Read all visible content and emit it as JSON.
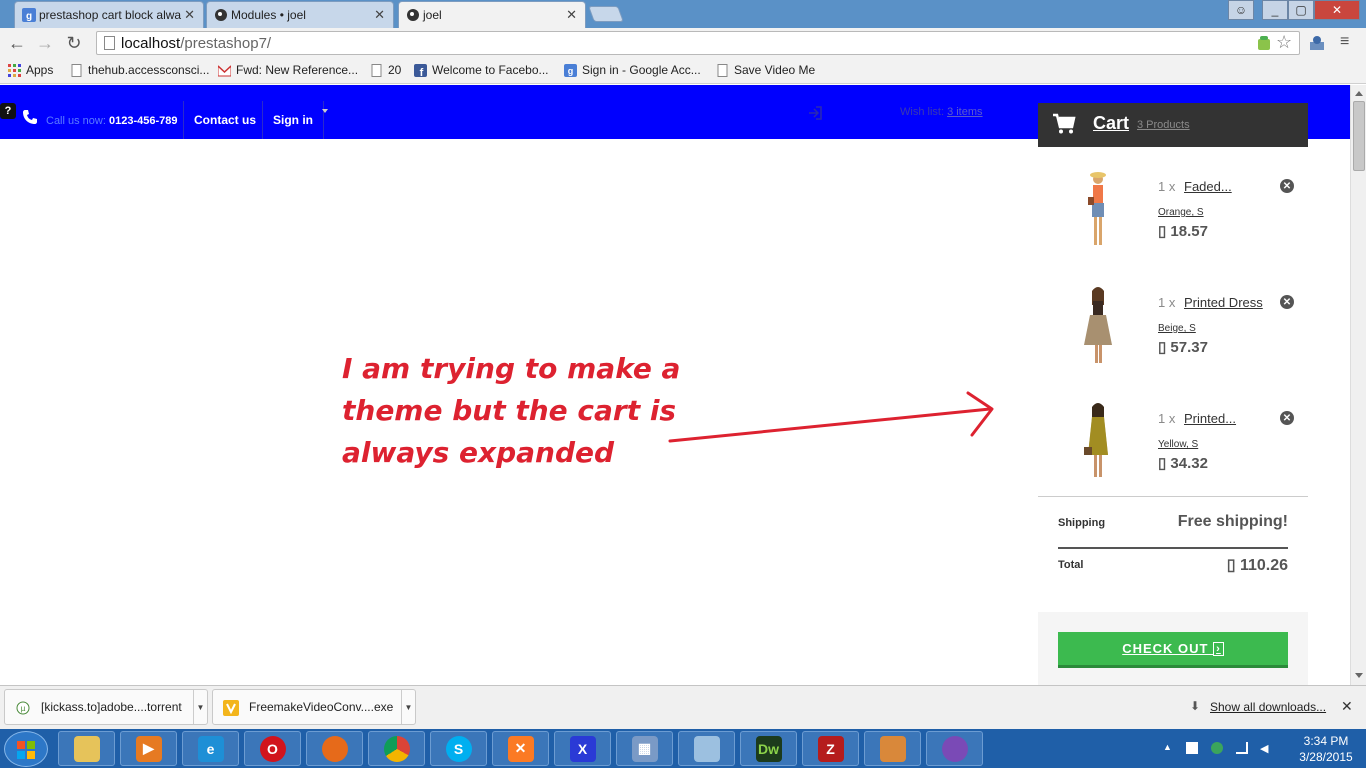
{
  "browser": {
    "tabs": [
      {
        "title": "prestashop cart block alwa"
      },
      {
        "title": "Modules • joel"
      },
      {
        "title": "joel"
      }
    ],
    "url_host": "localhost",
    "url_path": "/prestashop7/"
  },
  "bookmarks": [
    {
      "label": "Apps",
      "icon": "apps-grid-icon"
    },
    {
      "label": "thehub.accessconsci...",
      "icon": "page-icon"
    },
    {
      "label": "Fwd: New Reference...",
      "icon": "gmail-icon"
    },
    {
      "label": "20",
      "icon": "page-icon"
    },
    {
      "label": "Welcome to Facebo...",
      "icon": "facebook-icon"
    },
    {
      "label": "Sign in - Google Acc...",
      "icon": "google-icon"
    },
    {
      "label": "Save Video Me",
      "icon": "page-icon"
    }
  ],
  "header": {
    "help": "?",
    "call_label": "Call us now:",
    "phone": "0123-456-789",
    "contact": "Contact us",
    "signin": "Sign in",
    "wishlist_label": "Wish list:",
    "wishlist_count": "3 items"
  },
  "cart": {
    "title": "Cart",
    "count_label": "3 Products",
    "items": [
      {
        "qty": "1 x",
        "name": "Faded...",
        "attrs": "Orange, S",
        "price": " 18.57"
      },
      {
        "qty": "1 x",
        "name": "Printed Dress",
        "attrs": "Beige, S",
        "price": " 57.37"
      },
      {
        "qty": "1 x",
        "name": "Printed...",
        "attrs": "Yellow, S",
        "price": " 34.32"
      }
    ],
    "shipping_label": "Shipping",
    "shipping_value": "Free shipping!",
    "total_label": "Total",
    "total_value": " 110.26",
    "checkout": "CHECK OUT"
  },
  "annotation": {
    "line1": "I am trying to make a",
    "line2": "theme but the cart is",
    "line3": "always expanded"
  },
  "downloads": {
    "items": [
      {
        "name": "[kickass.to]adobe....torrent"
      },
      {
        "name": "FreemakeVideoConv....exe"
      }
    ],
    "show_all": "Show all downloads..."
  },
  "taskbar": {
    "time": "3:34 PM",
    "date": "3/28/2015",
    "apps": [
      "explorer",
      "media-player",
      "internet-explorer",
      "opera",
      "firefox",
      "chrome",
      "skype",
      "xampp",
      "app-x",
      "control-panel",
      "notepad",
      "dreamweaver",
      "filezilla",
      "package",
      "messenger"
    ]
  },
  "colors": {
    "topbar": "#0000fe",
    "checkout": "#3cba4f",
    "annotation": "#dd2230"
  }
}
